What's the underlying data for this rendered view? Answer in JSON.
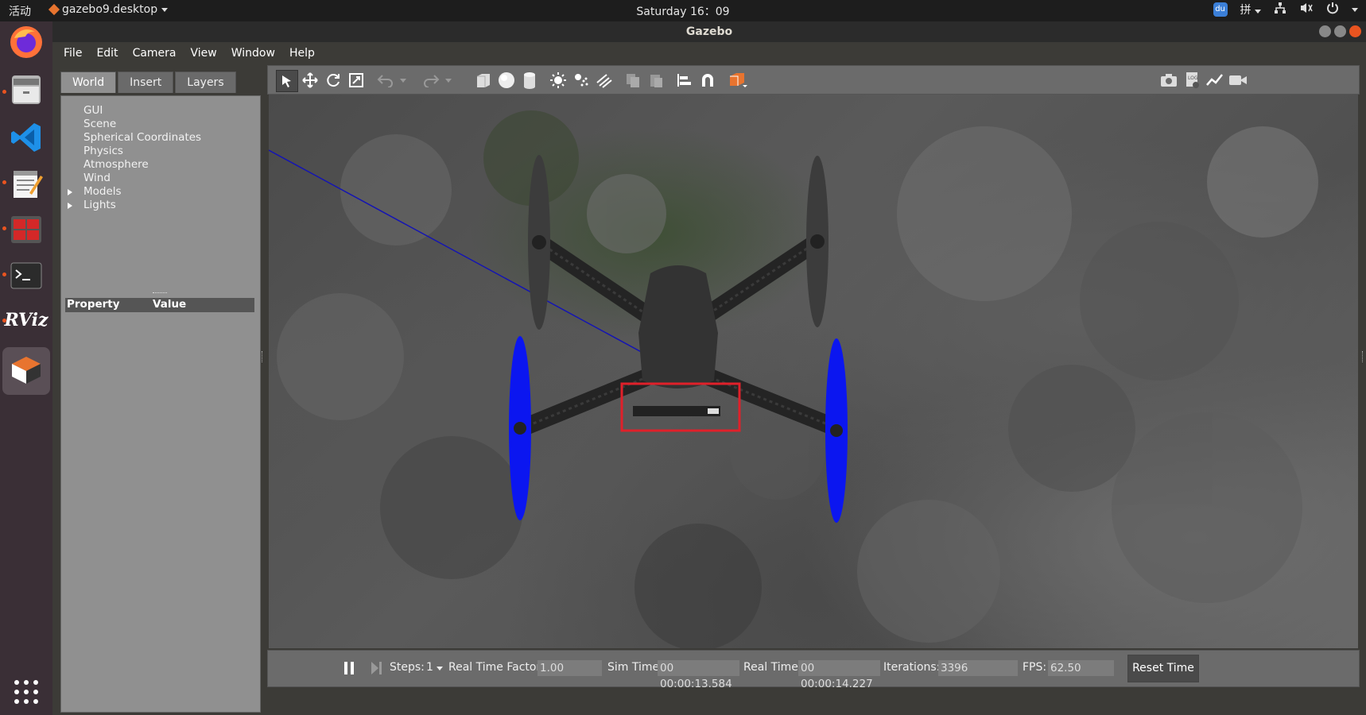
{
  "topbar": {
    "activities": "活动",
    "app_name": "gazebo9.desktop",
    "clock": "Saturday 16：09",
    "input_method": "拼"
  },
  "dock": {
    "apps": [
      {
        "name": "firefox-icon"
      },
      {
        "name": "files-icon"
      },
      {
        "name": "vscode-icon"
      },
      {
        "name": "text-editor-icon"
      },
      {
        "name": "terminal-red-icon"
      },
      {
        "name": "terminal-icon"
      },
      {
        "name": "rviz-icon",
        "label": "RViz"
      },
      {
        "name": "gazebo-icon"
      }
    ]
  },
  "window": {
    "title": "Gazebo",
    "menu": [
      "File",
      "Edit",
      "Camera",
      "View",
      "Window",
      "Help"
    ]
  },
  "left_panel": {
    "tabs": [
      "World",
      "Insert",
      "Layers"
    ],
    "active_tab": "World",
    "tree": [
      {
        "label": "GUI",
        "expandable": false
      },
      {
        "label": "Scene",
        "expandable": false
      },
      {
        "label": "Spherical Coordinates",
        "expandable": false
      },
      {
        "label": "Physics",
        "expandable": false
      },
      {
        "label": "Atmosphere",
        "expandable": false
      },
      {
        "label": "Wind",
        "expandable": false
      },
      {
        "label": "Models",
        "expandable": true
      },
      {
        "label": "Lights",
        "expandable": true
      }
    ],
    "property_header": "Property",
    "value_header": "Value"
  },
  "toolbar": {
    "tools": [
      "select-arrow-icon",
      "translate-icon",
      "rotate-icon",
      "scale-icon",
      "undo-icon",
      "redo-icon",
      "box-icon",
      "sphere-icon",
      "cylinder-icon",
      "point-light-icon",
      "spot-light-icon",
      "directional-light-icon",
      "copy-icon",
      "paste-icon",
      "align-icon",
      "snap-icon",
      "view-angle-icon",
      "screenshot-icon",
      "log-icon",
      "plot-icon",
      "video-record-icon"
    ]
  },
  "bottom_bar": {
    "steps_label": "Steps:",
    "steps_value": "1",
    "rtf_label": "Real Time Factor:",
    "rtf_value": "1.00",
    "sim_time_label": "Sim Time:",
    "sim_time_value": "00 00:00:13.584",
    "real_time_label": "Real Time:",
    "real_time_value": "00 00:00:14.227",
    "iterations_label": "Iterations:",
    "iterations_value": "3396",
    "fps_label": "FPS:",
    "fps_value": "62.50",
    "reset_label": "Reset Time"
  },
  "colors": {
    "propeller_highlight": "#0b16f0",
    "selection_box": "#e0202a",
    "accent": "#e95420"
  }
}
